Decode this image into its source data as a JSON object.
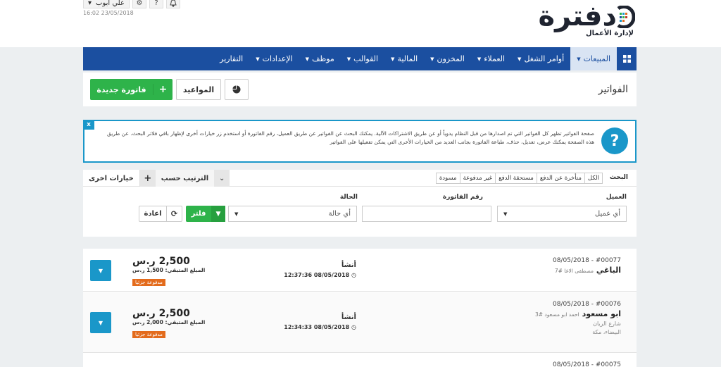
{
  "header": {
    "user_name": "علي أبوب",
    "datetime": "16:02 23/05/2018",
    "logo_text": "دفترة",
    "logo_sub": "لإدارة الأعمال"
  },
  "nav": {
    "items": [
      {
        "label": "المبيعات",
        "caret": true,
        "active": true
      },
      {
        "label": "أوامر الشغل",
        "caret": true
      },
      {
        "label": "العملاء",
        "caret": true
      },
      {
        "label": "المخزون",
        "caret": true
      },
      {
        "label": "المالية",
        "caret": true
      },
      {
        "label": "القوالب",
        "caret": true
      },
      {
        "label": "موظف",
        "caret": true
      },
      {
        "label": "الإعدادات",
        "caret": true
      },
      {
        "label": "التقارير",
        "caret": false
      }
    ]
  },
  "title_panel": {
    "title": "الفواتير",
    "new_invoice": "فاتورة جديدة",
    "appointments": "المواعيد"
  },
  "help": {
    "close": "x",
    "icon": "?",
    "text": "صفحة الفواتير تظهر كل الفواتير التي تم اصدارها من قبل النظام يدوياً أو عن طريق الاشتراكات الآلية. يمكنك البحث عن الفواتير عن طريق العميل، رقم الفاتورة أو استخدم زر خيارات أخرى لإظهار باقي فلاتر البحث. عن طريق هذه الصفحة يمكنك عرض، تعديل، حذف، طباعة الفاتورة بجانب العديد من الخيارات الأخرى التي يمكن تفعيلها على الفواتير"
  },
  "search": {
    "label": "البحث",
    "tabs": [
      "الكل",
      "متأخرة عن الدفع",
      "مستحقة الدفع",
      "غير مدفوعة",
      "مسودة"
    ],
    "more_options": "خيارات اخرى",
    "sort_by": "الترتيب حسب",
    "client_label": "العميل",
    "client_placeholder": "أي عميل",
    "invoice_no_label": "رقم الفاتورة",
    "invoice_no_value": "",
    "status_label": "الحالة",
    "status_placeholder": "أي حالة",
    "filter_btn": "فلتر",
    "reset_btn": "اعادة"
  },
  "invoices": [
    {
      "number": "#00077",
      "date": "08/05/2018",
      "client": "الباغي",
      "client_sub": "مصطفى الاغا #7",
      "address1": "",
      "address2": "",
      "status": "أنشأ",
      "timestamp": "12:37:36 08/05/2018",
      "amount": "2,500 ر.س",
      "due": "المبلغ المتبقي: 1,500 ر.س",
      "badge": "مدفوعة جزئيا"
    },
    {
      "number": "#00076",
      "date": "08/05/2018",
      "client": "ابو مسعود",
      "client_sub": "احمد ابو مسعود #3",
      "address1": "شارع الريان",
      "address2": "البيضاء، مكة",
      "status": "أنشأ",
      "timestamp": "12:34:33 08/05/2018",
      "amount": "2,500 ر.س",
      "due": "المبلغ المتبقي: 2,000 ر.س",
      "badge": "مدفوعة جزئيا"
    },
    {
      "number": "#00075",
      "date": "08/05/2018"
    }
  ],
  "colors": {
    "nav_bg": "#1b4fa0",
    "green": "#2eb34a",
    "info": "#1a97c9",
    "badge": "#e36b1c"
  }
}
